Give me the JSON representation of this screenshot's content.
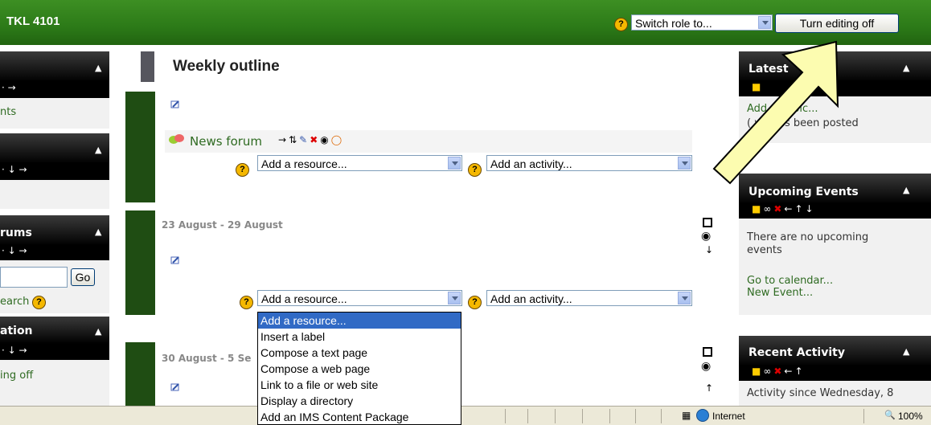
{
  "header": {
    "site_title": "TKL 4101",
    "switch_role": "Switch role to...",
    "editing_button": "Turn editing off"
  },
  "left_blocks": {
    "block1_text": "nts",
    "block3_title": "rums",
    "go_button": "Go",
    "search_text": "earch",
    "block4_title": "ation",
    "block4_text": "ing off"
  },
  "main": {
    "title": "Weekly outline",
    "news_forum": "News forum",
    "add_resource": "Add a resource...",
    "add_activity": "Add an activity...",
    "week1": "23 August - 29 August",
    "week2": "30 August - 5 Se"
  },
  "dropdown": {
    "options": [
      "Add a resource...",
      "Insert a label",
      "Compose a text page",
      "Compose a web page",
      "Link to a file or web site",
      "Display a directory",
      "Add an IMS Content Package"
    ]
  },
  "right_blocks": {
    "latest_title": "Latest",
    "latest_line1": "Add  w topic...",
    "latest_line2": "(  ws has been posted",
    "upcoming_title": "Upcoming Events",
    "upcoming_text1": "There are no upcoming",
    "upcoming_text2": "events",
    "go_calendar": "Go to calendar...",
    "new_event": "New Event...",
    "recent_title": "Recent Activity",
    "recent_text": "Activity since Wednesday, 8"
  },
  "statusbar": {
    "zone": "Internet",
    "zoom": "100%"
  },
  "colors": {
    "header_green": "#2c7a18",
    "arrow_fill": "#fcfcb0",
    "highlight": "#316ac5"
  }
}
